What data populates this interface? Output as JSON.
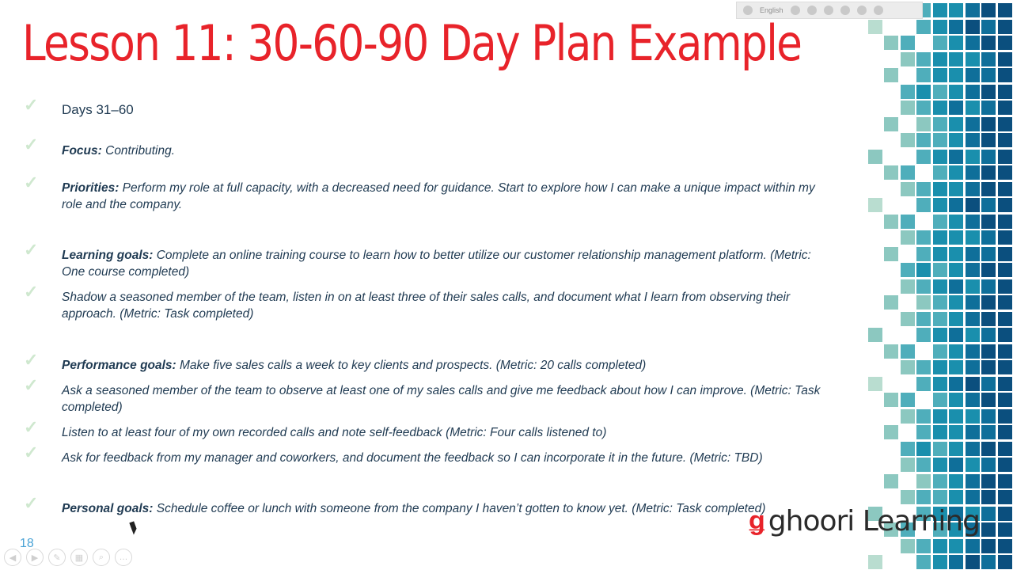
{
  "title": "Lesson 11: 30-60-90 Day Plan Example",
  "section_heading": "Days 31–60",
  "items": [
    {
      "label": "Focus:",
      "text": " Contributing."
    },
    {
      "label": "Priorities:",
      "text": " Perform my role at full capacity, with a decreased need for guidance. Start to explore how I can make a unique impact within my role and the company."
    },
    {
      "label": "Learning goals:",
      "text": " Complete an online training course to learn how to better utilize our customer relationship management platform. (Metric: One course completed)"
    },
    {
      "label": "",
      "text": "Shadow a seasoned member of the team, listen in on at least three of their sales calls, and document what I learn from observing their approach. (Metric: Task completed)"
    },
    {
      "label": "Performance goals:",
      "text": " Make five sales calls a week to key clients and prospects. (Metric: 20 calls completed)"
    },
    {
      "label": "",
      "text": "Ask a seasoned member of the team to observe at least one of my sales calls and give me feedback about how I can improve. (Metric: Task completed)"
    },
    {
      "label": "",
      "text": "Listen to at least four of my own recorded calls and note self-feedback (Metric: Four calls listened to)"
    },
    {
      "label": "",
      "text": "Ask for feedback from my manager and coworkers, and document the feedback so I can incorporate it in the future. (Metric: TBD)"
    },
    {
      "label": "Personal goals:",
      "text": " Schedule coffee or lunch with someone from the company I haven’t gotten to know yet. (Metric: Task completed)"
    }
  ],
  "page_number": "18",
  "toolbar": {
    "language": "English"
  },
  "logo": {
    "mark": "ǥ",
    "text": "ghoori Learning"
  },
  "colors": {
    "title": "#e8232a",
    "body_text": "#1f3a52",
    "check": "#cfe8cf",
    "accent": "#1a7fa6"
  },
  "icons": [
    "checkmark-icon",
    "play-prev-icon",
    "play-next-icon",
    "pen-icon",
    "slides-icon",
    "zoom-icon",
    "more-icon"
  ]
}
